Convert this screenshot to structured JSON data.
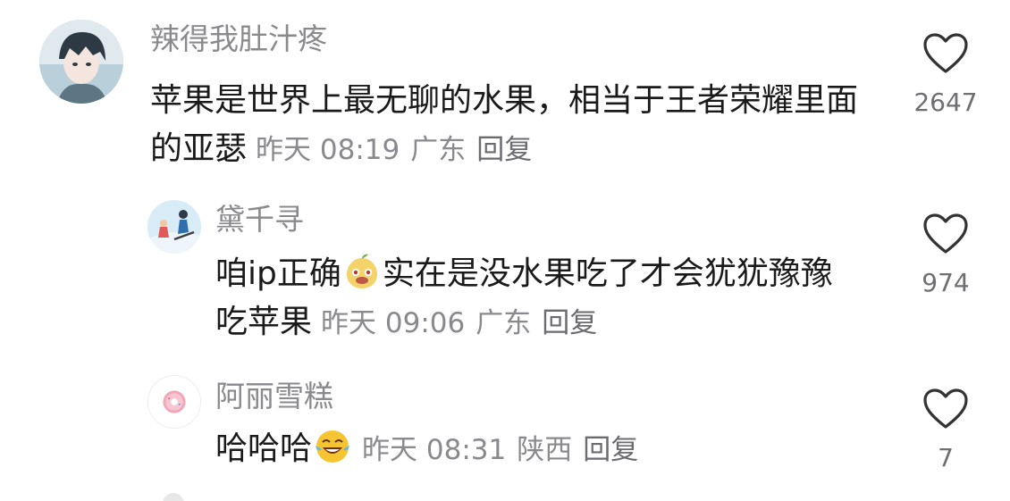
{
  "comments": [
    {
      "username": "辣得我肚汁疼",
      "text_before": "苹果是世界上最无聊的水果，相当于王者荣耀里面的亚瑟",
      "text_after": "",
      "emoji": "",
      "time": "昨天 08:19",
      "location": "广东",
      "reply_label": "回复",
      "likes": "2647",
      "avatar_icon": "anime-boy-avatar"
    },
    {
      "username": "黛千寻",
      "text_before": "咱ip正确",
      "text_after": "实在是没水果吃了才会犹犹豫豫吃苹果",
      "emoji": "pear-face-emoji",
      "time": "昨天 09:06",
      "location": "广东",
      "reply_label": "回复",
      "likes": "974",
      "avatar_icon": "skiing-avatar"
    },
    {
      "username": "阿丽雪糕",
      "text_before": "哈哈哈",
      "text_after": "",
      "emoji": "laughing-tears-emoji",
      "time": "昨天 08:31",
      "location": "陕西",
      "reply_label": "回复",
      "likes": "7",
      "avatar_icon": "donut-avatar"
    }
  ],
  "colors": {
    "text": "#1a1a1a",
    "muted": "#8a8a8e",
    "heart_stroke": "#333333"
  }
}
